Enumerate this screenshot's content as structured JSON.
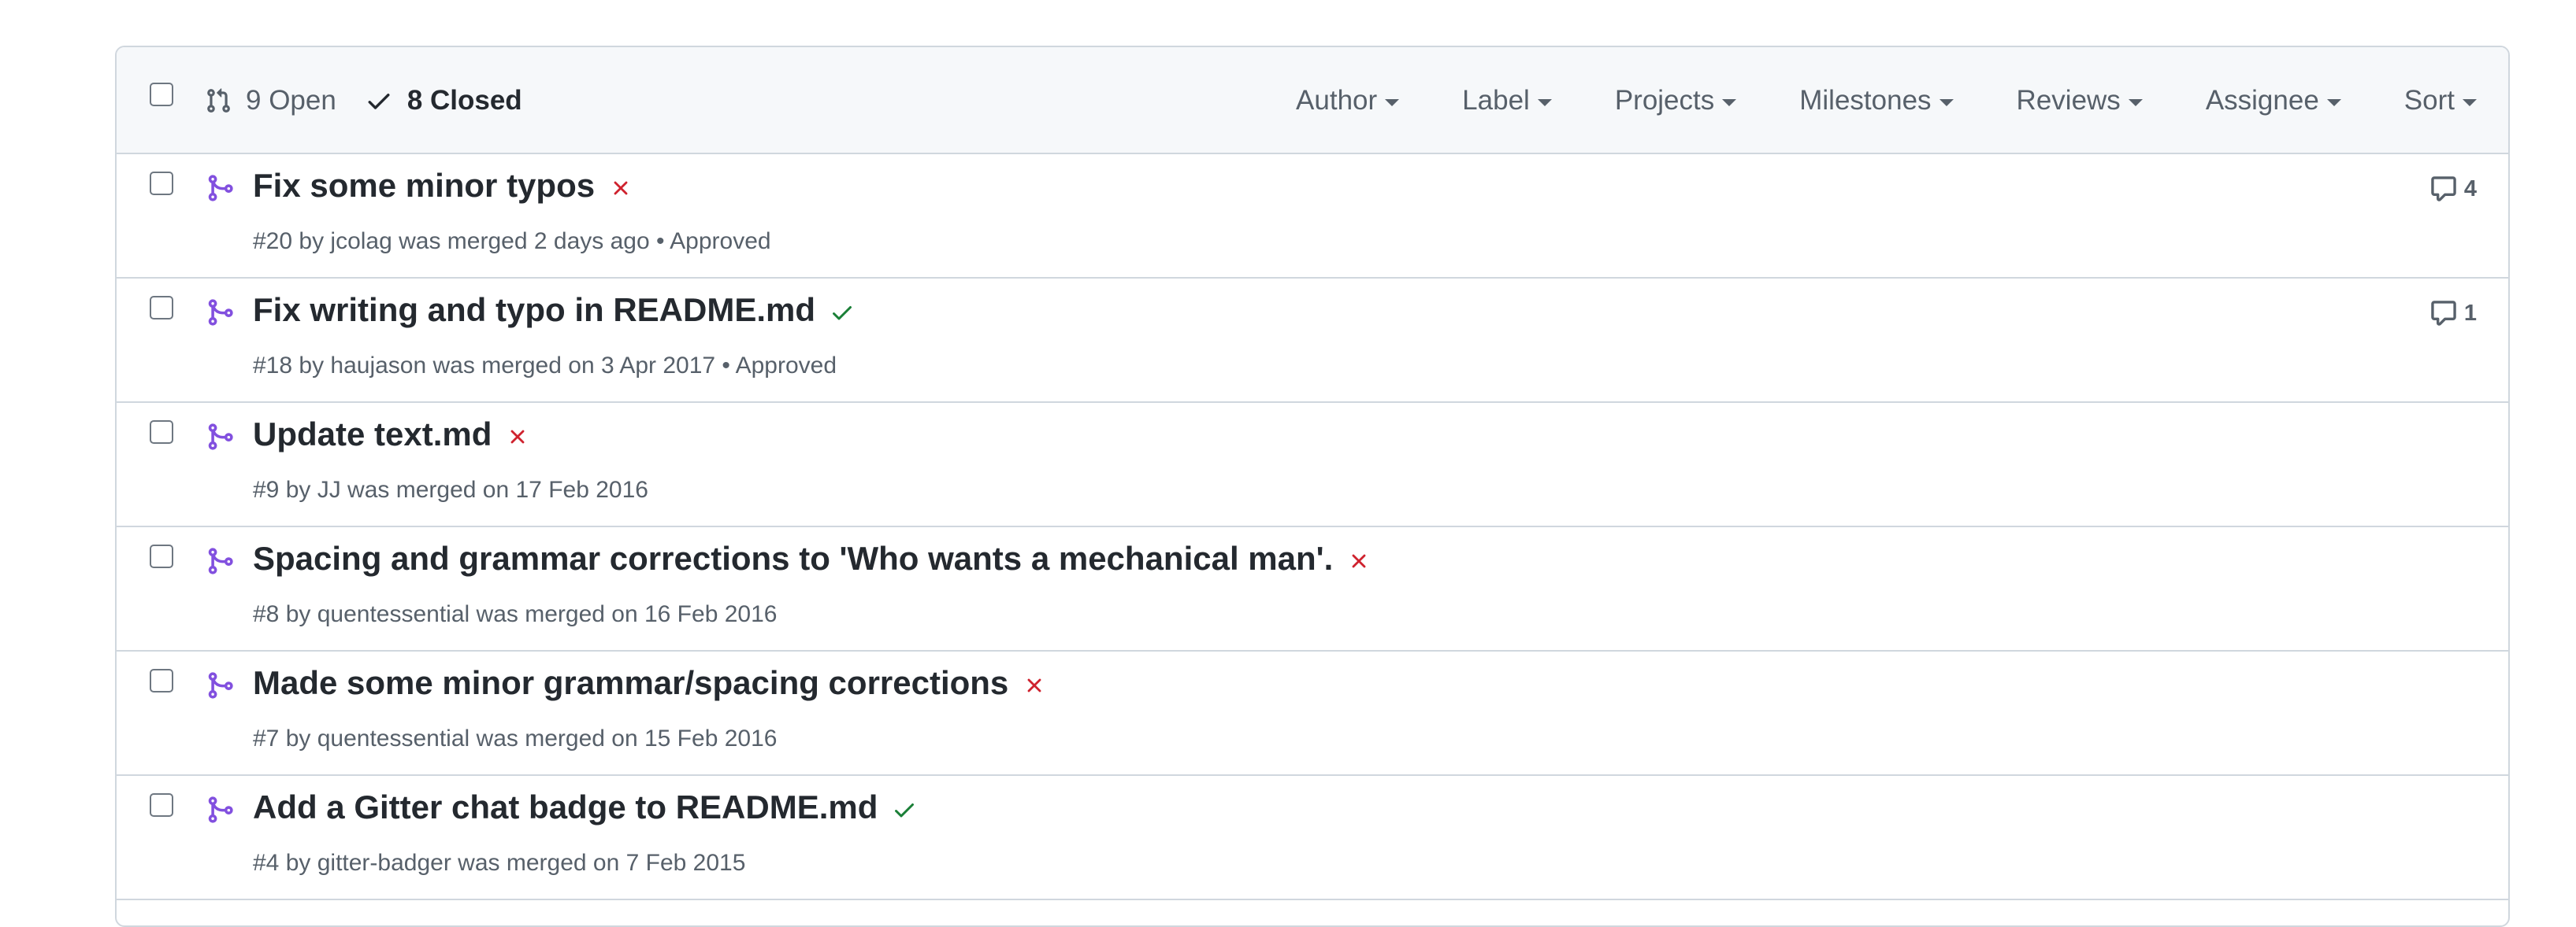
{
  "header": {
    "open_label": "9 Open",
    "closed_label": "8 Closed",
    "filters": [
      "Author",
      "Label",
      "Projects",
      "Milestones",
      "Reviews",
      "Assignee",
      "Sort"
    ]
  },
  "colors": {
    "merged_purple": "#8250df",
    "fail_red": "#cf222e",
    "success_green": "#1a7f37"
  },
  "pull_requests": [
    {
      "title": "Fix some minor typos",
      "status": "fail",
      "meta": "#20 by jcolag was merged 2 days ago • Approved",
      "comments": "4"
    },
    {
      "title": "Fix writing and typo in README.md",
      "status": "success",
      "meta": "#18 by haujason was merged on 3 Apr 2017 • Approved",
      "comments": "1"
    },
    {
      "title": "Update text.md",
      "status": "fail",
      "meta": "#9 by JJ was merged on 17 Feb 2016",
      "comments": ""
    },
    {
      "title": "Spacing and grammar corrections to 'Who wants a mechanical man'.",
      "status": "fail",
      "meta": "#8 by quentessential was merged on 16 Feb 2016",
      "comments": ""
    },
    {
      "title": "Made some minor grammar/spacing corrections",
      "status": "fail",
      "meta": "#7 by quentessential was merged on 15 Feb 2016",
      "comments": ""
    },
    {
      "title": "Add a Gitter chat badge to README.md",
      "status": "success",
      "meta": "#4 by gitter-badger was merged on 7 Feb 2015",
      "comments": ""
    }
  ]
}
